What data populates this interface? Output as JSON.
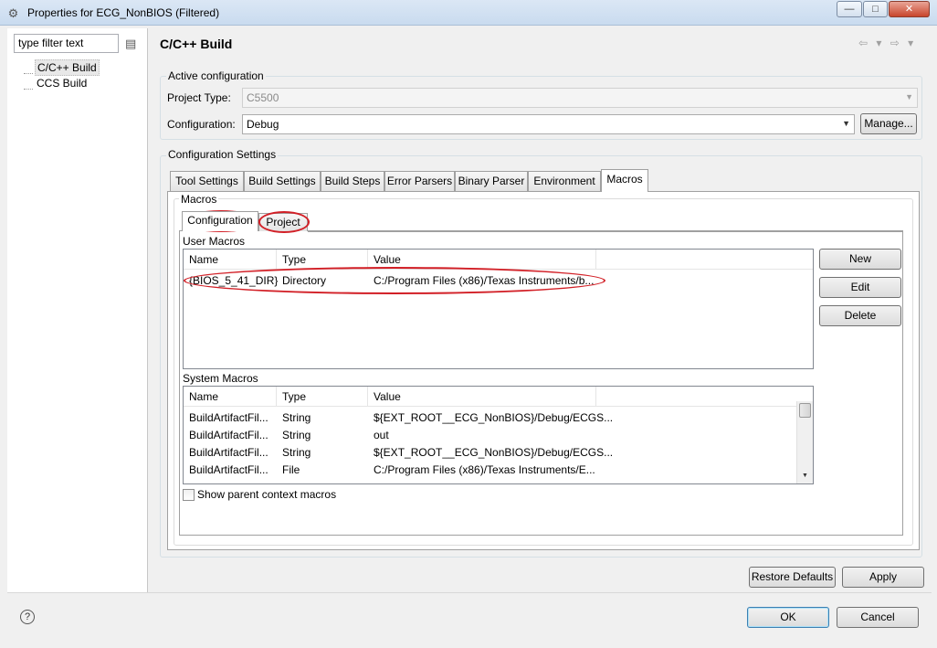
{
  "window": {
    "title": "Properties for ECG_NonBIOS (Filtered)",
    "minimize": "—",
    "maximize": "□",
    "close": "✕"
  },
  "left": {
    "filter_placeholder": "type filter text",
    "tree": [
      {
        "label": "C/C++ Build",
        "selected": true
      },
      {
        "label": "CCS Build",
        "selected": false
      }
    ]
  },
  "header": {
    "title": "C/C++ Build",
    "nav": "⇦ ▾ ⇨ ▾"
  },
  "active_config": {
    "group_label": "Active configuration",
    "project_type_label": "Project Type:",
    "project_type_value": "C5500",
    "configuration_label": "Configuration:",
    "configuration_value": "Debug",
    "manage_label": "Manage..."
  },
  "config_settings": {
    "group_label": "Configuration Settings",
    "tabs": [
      "Tool Settings",
      "Build Settings",
      "Build Steps",
      "Error Parsers",
      "Binary Parser",
      "Environment",
      "Macros"
    ],
    "active_tab": "Macros"
  },
  "macros": {
    "group_label": "Macros",
    "subtabs": [
      "Configuration",
      "Project"
    ],
    "user_macros_label": "User Macros",
    "columns": [
      "Name",
      "Type",
      "Value"
    ],
    "user_rows": [
      {
        "name": "{BIOS_5_41_DIR}",
        "type": "Directory",
        "value": "C:/Program Files (x86)/Texas Instruments/b..."
      }
    ],
    "buttons": {
      "new": "New",
      "edit": "Edit",
      "delete": "Delete"
    },
    "system_macros_label": "System Macros",
    "system_rows": [
      {
        "name": "BuildArtifactFil...",
        "type": "String",
        "value": "${EXT_ROOT__ECG_NonBIOS}/Debug/ECGS..."
      },
      {
        "name": "BuildArtifactFil...",
        "type": "String",
        "value": "out"
      },
      {
        "name": "BuildArtifactFil...",
        "type": "String",
        "value": "${EXT_ROOT__ECG_NonBIOS}/Debug/ECGS..."
      },
      {
        "name": "BuildArtifactFil...",
        "type": "File",
        "value": "C:/Program Files (x86)/Texas Instruments/E..."
      }
    ],
    "show_parent_label": "Show parent context macros",
    "show_parent_checked": false
  },
  "footer": {
    "restore_defaults": "Restore Defaults",
    "apply": "Apply",
    "ok": "OK",
    "cancel": "Cancel",
    "help": "?"
  },
  "colors": {
    "annotation": "#d21f26",
    "window_bg": "#f0f0f0"
  }
}
